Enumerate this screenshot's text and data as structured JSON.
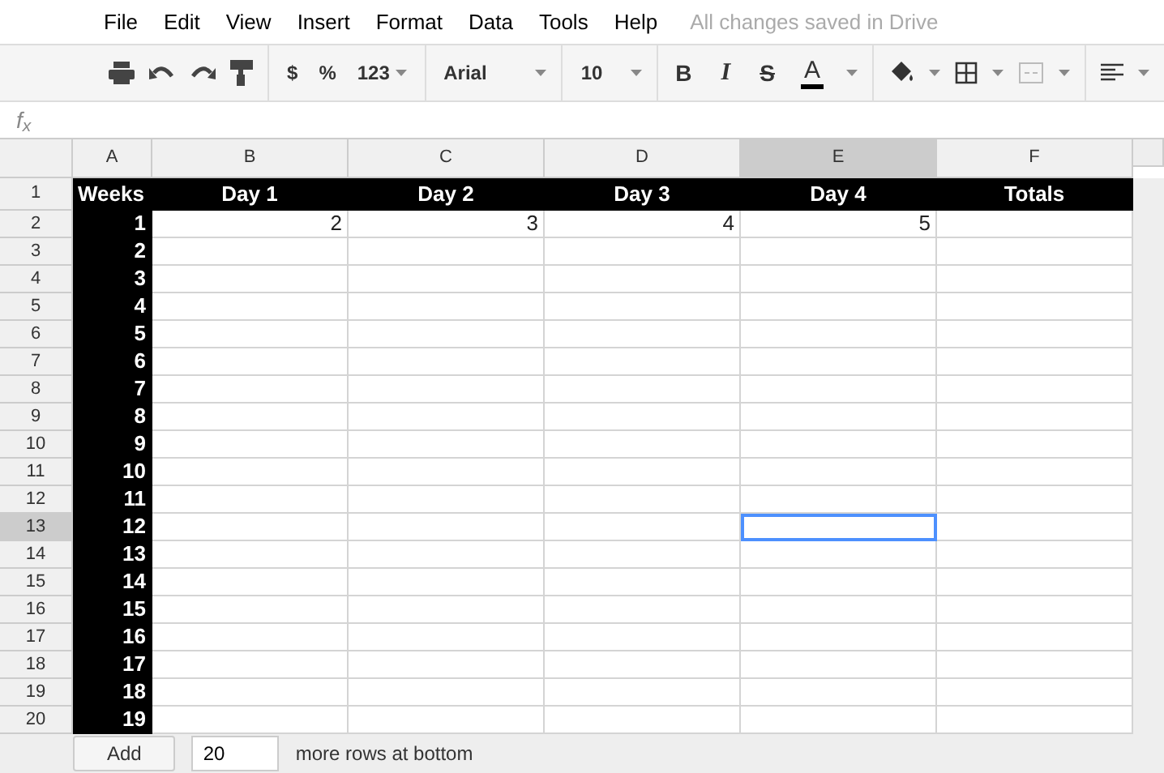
{
  "menu": [
    "File",
    "Edit",
    "View",
    "Insert",
    "Format",
    "Data",
    "Tools",
    "Help"
  ],
  "save_status": "All changes saved in Drive",
  "toolbar": {
    "currency": "$",
    "percent": "%",
    "number_format": "123",
    "font": "Arial",
    "font_size": "10",
    "bold": "B",
    "italic": "I",
    "strikethrough": "S",
    "text_color": "A"
  },
  "formula_bar": {
    "label": "f$_{x}$"
  },
  "columns": [
    {
      "label": "A",
      "selected": false
    },
    {
      "label": "B",
      "selected": false
    },
    {
      "label": "C",
      "selected": false
    },
    {
      "label": "D",
      "selected": false
    },
    {
      "label": "E",
      "selected": true
    },
    {
      "label": "F",
      "selected": false
    }
  ],
  "rows": [
    {
      "number": "1",
      "selected": false,
      "kind": "header",
      "cells": [
        "Weeks",
        "Day 1",
        "Day 2",
        "Day 3",
        "Day 4",
        "Totals"
      ]
    },
    {
      "number": "2",
      "selected": false,
      "cells": [
        "1",
        "2",
        "3",
        "4",
        "5"
      ]
    },
    {
      "number": "3",
      "selected": false,
      "cells": [
        "2"
      ]
    },
    {
      "number": "4",
      "selected": false,
      "cells": [
        "3"
      ]
    },
    {
      "number": "5",
      "selected": false,
      "cells": [
        "4"
      ]
    },
    {
      "number": "6",
      "selected": false,
      "cells": [
        "5"
      ]
    },
    {
      "number": "7",
      "selected": false,
      "cells": [
        "6"
      ]
    },
    {
      "number": "8",
      "selected": false,
      "cells": [
        "7"
      ]
    },
    {
      "number": "9",
      "selected": false,
      "cells": [
        "8"
      ]
    },
    {
      "number": "10",
      "selected": false,
      "cells": [
        "9"
      ]
    },
    {
      "number": "11",
      "selected": false,
      "cells": [
        "10"
      ]
    },
    {
      "number": "12",
      "selected": false,
      "cells": [
        "11"
      ]
    },
    {
      "number": "13",
      "selected": true,
      "cells": [
        "12"
      ]
    },
    {
      "number": "14",
      "selected": false,
      "cells": [
        "13"
      ]
    },
    {
      "number": "15",
      "selected": false,
      "cells": [
        "14"
      ]
    },
    {
      "number": "16",
      "selected": false,
      "cells": [
        "15"
      ]
    },
    {
      "number": "17",
      "selected": false,
      "cells": [
        "16"
      ]
    },
    {
      "number": "18",
      "selected": false,
      "cells": [
        "17"
      ]
    },
    {
      "number": "19",
      "selected": false,
      "cells": [
        "18"
      ]
    },
    {
      "number": "20",
      "selected": false,
      "cells": [
        "19"
      ]
    }
  ],
  "footer": {
    "button": "Add",
    "value": "20",
    "text": "more rows at bottom"
  }
}
